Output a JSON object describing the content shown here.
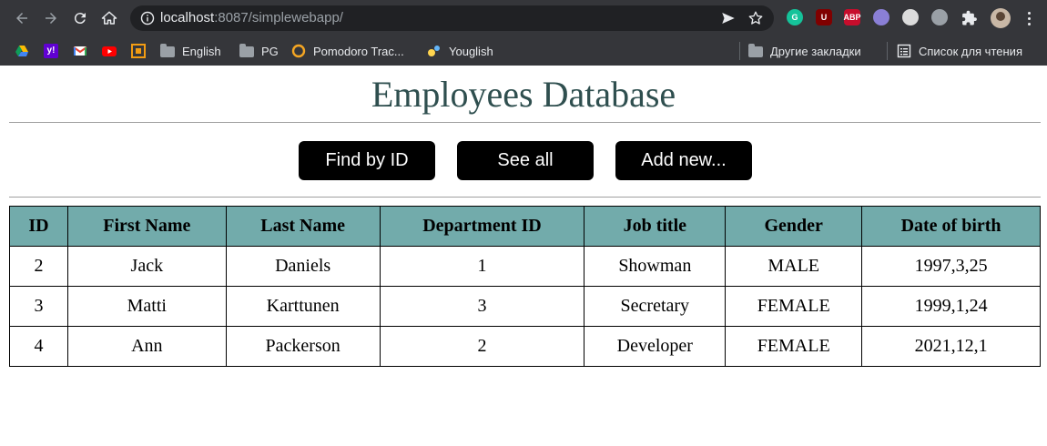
{
  "browser": {
    "url_host": "localhost",
    "url_rest": ":8087/simplewebapp/",
    "extensions": [
      {
        "name": "grammarly",
        "label": "G",
        "color": "#15c39a"
      },
      {
        "name": "ublock",
        "label": "U",
        "color": "#800000"
      },
      {
        "name": "adblock-plus",
        "label": "ABP",
        "color": "#c70d2c"
      },
      {
        "name": "drop",
        "label": "",
        "color": "#8a7fd6"
      },
      {
        "name": "eyedropper",
        "label": "",
        "color": "#dcdcdc"
      },
      {
        "name": "settings-ext",
        "label": "",
        "color": "#9aa0a6"
      }
    ],
    "bookmarks": [
      {
        "label": "",
        "icon": "google-drive-icon"
      },
      {
        "label": "",
        "icon": "yahoo-icon"
      },
      {
        "label": "",
        "icon": "gmail-icon"
      },
      {
        "label": "",
        "icon": "youtube-icon"
      },
      {
        "label": "",
        "icon": "orange-square-icon"
      },
      {
        "label": "English",
        "icon": "folder-icon"
      },
      {
        "label": "PG",
        "icon": "folder-icon"
      },
      {
        "label": "Pomodoro Trac...",
        "icon": "circle-icon"
      },
      {
        "label": "Youglish",
        "icon": "youglish-icon"
      }
    ],
    "other_bookmarks": "Другие закладки",
    "reading_list": "Список для чтения"
  },
  "page": {
    "title": "Employees Database",
    "buttons": {
      "find_by_id": "Find by ID",
      "see_all": "See all",
      "add_new": "Add new..."
    }
  },
  "table": {
    "headers": [
      "ID",
      "First Name",
      "Last Name",
      "Department ID",
      "Job title",
      "Gender",
      "Date of birth"
    ],
    "rows": [
      [
        "2",
        "Jack",
        "Daniels",
        "1",
        "Showman",
        "MALE",
        "1997,3,25"
      ],
      [
        "3",
        "Matti",
        "Karttunen",
        "3",
        "Secretary",
        "FEMALE",
        "1999,1,24"
      ],
      [
        "4",
        "Ann",
        "Packerson",
        "2",
        "Developer",
        "FEMALE",
        "2021,12,1"
      ]
    ]
  },
  "colors": {
    "title": "#2f4f4f",
    "table_header_bg": "#72abab",
    "button_bg": "#000000",
    "button_text": "#ffffff"
  }
}
